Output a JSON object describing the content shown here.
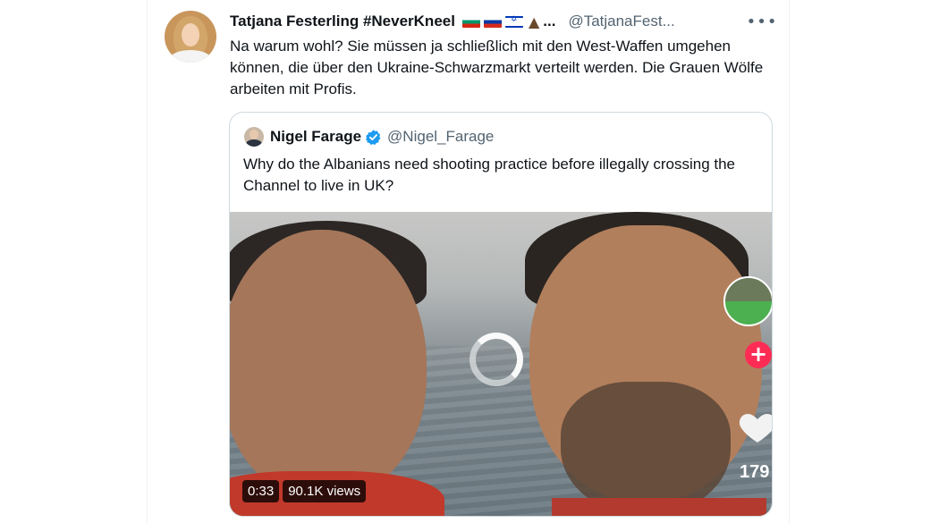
{
  "tweet": {
    "author_name": "Tatjana Festerling #NeverKneel",
    "flags": [
      "bulgaria-flag",
      "russia-flag",
      "israel-flag",
      "volcano"
    ],
    "name_ellipsis": "...",
    "author_handle": "@TatjanaFest...",
    "more_label": "•••",
    "text": "Na warum wohl? Sie müssen ja schließlich mit den West-Waffen umgehen können, die über den Ukraine-Schwarzmarkt verteilt werden. Die Grauen Wölfe arbeiten mit Profis."
  },
  "quoted": {
    "author_name": "Nigel Farage",
    "verified": true,
    "author_handle": "@Nigel_Farage",
    "text": "Why do the Albanians need shooting practice before illegally crossing the Channel to live in UK?",
    "video": {
      "duration": "0:33",
      "views": "90.1K views",
      "like_count": "179",
      "plus_label": "+"
    }
  },
  "colors": {
    "text": "#0f1419",
    "muted": "#536471",
    "border": "#cfd9de",
    "verified": "#1d9bf0",
    "tiktok_red": "#fe2c55"
  }
}
